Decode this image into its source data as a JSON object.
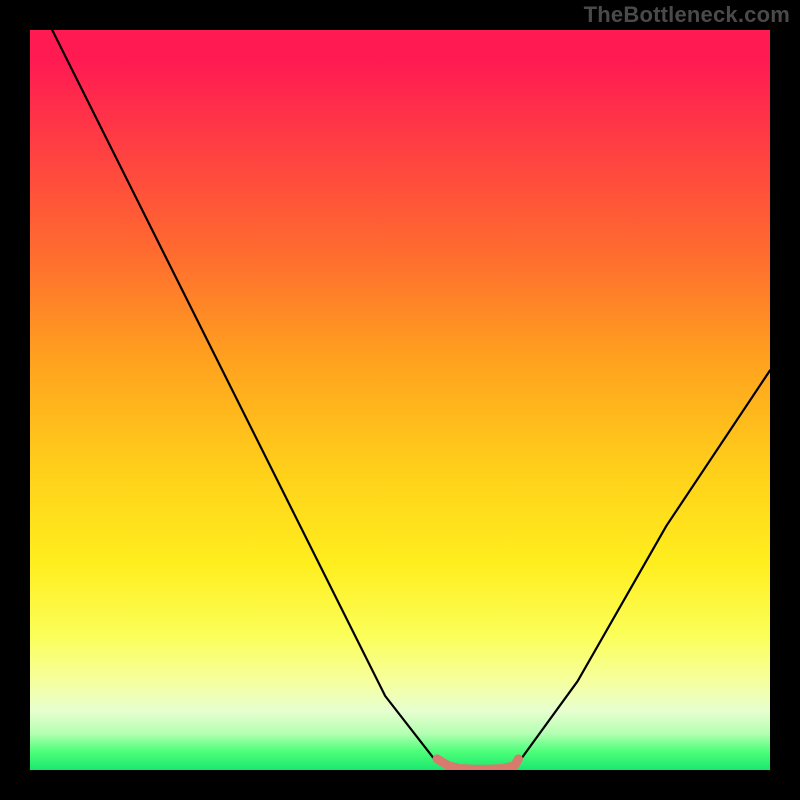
{
  "watermark": "TheBottleneck.com",
  "chart_data": {
    "type": "line",
    "title": "",
    "xlabel": "",
    "ylabel": "",
    "xlim": [
      0,
      100
    ],
    "ylim": [
      0,
      100
    ],
    "grid": false,
    "series": [
      {
        "name": "bottleneck-curve",
        "x": [
          3,
          18,
          34,
          48,
          55,
          57,
          64,
          66,
          74,
          86,
          100
        ],
        "values": [
          100,
          70,
          38,
          10,
          1,
          0,
          0,
          1,
          12,
          33,
          54
        ],
        "color": "#000000"
      },
      {
        "name": "optimal-range-highlight",
        "x": [
          55,
          56.5,
          58,
          60,
          62,
          64,
          65.5,
          66
        ],
        "values": [
          1.5,
          0.6,
          0.2,
          0.1,
          0.1,
          0.2,
          0.6,
          1.5
        ],
        "color": "#d97a6f"
      }
    ],
    "annotations": []
  }
}
